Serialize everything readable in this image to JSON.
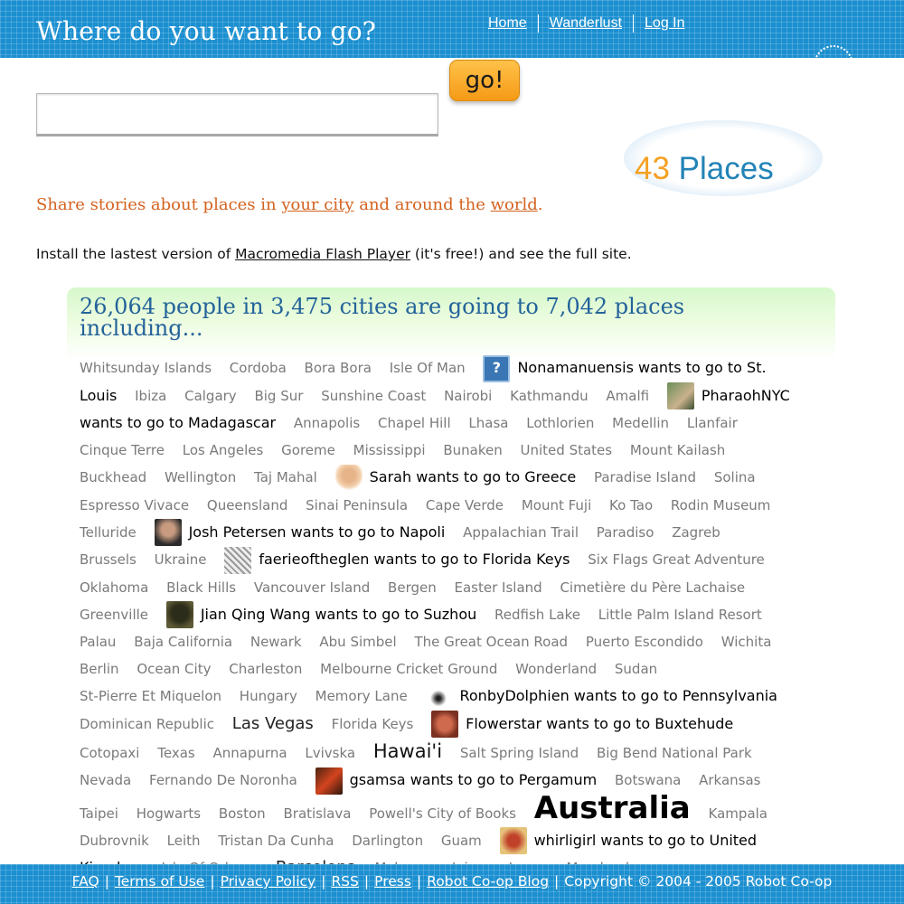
{
  "header": {
    "title": "Where do you want to go?",
    "nav": [
      "Home",
      "Wanderlust",
      "Log In"
    ]
  },
  "search": {
    "value": "",
    "placeholder": "",
    "go_label": "go!"
  },
  "logo": {
    "number": "43",
    "word": "Places"
  },
  "tagline": {
    "before": "Share stories about places in ",
    "link1": "your city",
    "middle": " and around the ",
    "link2": "world",
    "after": "."
  },
  "flash_note": {
    "before": "Install the lastest version of ",
    "link": "Macromedia Flash Player",
    "after": " (it's free!) and see the full site."
  },
  "stats": {
    "headline": "26,064 people in 3,475 cities are going to 7,042 places including..."
  },
  "cloud": [
    {
      "t": "place",
      "text": "Whitsunday Islands"
    },
    {
      "t": "place",
      "text": "Cordoba"
    },
    {
      "t": "place",
      "text": "Bora Bora"
    },
    {
      "t": "place",
      "text": "Isle Of Man"
    },
    {
      "t": "wish",
      "av": "av-q",
      "icon": "question-avatar-icon",
      "text": "Nonamanuensis wants to go to St. Louis"
    },
    {
      "t": "place",
      "text": "Ibiza"
    },
    {
      "t": "place",
      "text": "Calgary"
    },
    {
      "t": "place",
      "text": "Big Sur"
    },
    {
      "t": "place",
      "text": "Sunshine Coast"
    },
    {
      "t": "place",
      "text": "Nairobi"
    },
    {
      "t": "place",
      "text": "Kathmandu"
    },
    {
      "t": "place",
      "text": "Amalfi"
    },
    {
      "t": "wish",
      "av": "av-1",
      "icon": "user-avatar-icon",
      "text": "PharaohNYC wants to go to Madagascar"
    },
    {
      "t": "place",
      "text": "Annapolis"
    },
    {
      "t": "place",
      "text": "Chapel Hill"
    },
    {
      "t": "place",
      "text": "Lhasa"
    },
    {
      "t": "place",
      "text": "Lothlorien"
    },
    {
      "t": "place",
      "text": "Medellin"
    },
    {
      "t": "place",
      "text": "Llanfair"
    },
    {
      "t": "place",
      "text": "Cinque Terre"
    },
    {
      "t": "place",
      "text": "Los Angeles"
    },
    {
      "t": "place",
      "text": "Goreme"
    },
    {
      "t": "place",
      "text": "Mississippi"
    },
    {
      "t": "place",
      "text": "Bunaken"
    },
    {
      "t": "place",
      "text": "United States"
    },
    {
      "t": "place",
      "text": "Mount Kailash"
    },
    {
      "t": "place",
      "text": "Buckhead"
    },
    {
      "t": "place",
      "text": "Wellington"
    },
    {
      "t": "place",
      "text": "Taj Mahal"
    },
    {
      "t": "wish",
      "av": "av-2",
      "icon": "user-avatar-icon",
      "text": "Sarah wants to go to Greece"
    },
    {
      "t": "place",
      "text": "Paradise Island"
    },
    {
      "t": "place",
      "text": "Solina"
    },
    {
      "t": "place",
      "text": "Espresso Vivace"
    },
    {
      "t": "place",
      "text": "Queensland"
    },
    {
      "t": "place",
      "text": "Sinai Peninsula"
    },
    {
      "t": "place",
      "text": "Cape Verde"
    },
    {
      "t": "place",
      "text": "Mount Fuji"
    },
    {
      "t": "place",
      "text": "Ko Tao"
    },
    {
      "t": "place",
      "text": "Rodin Museum"
    },
    {
      "t": "place",
      "text": "Telluride"
    },
    {
      "t": "wish",
      "av": "av-3",
      "icon": "user-avatar-icon",
      "text": "Josh Petersen wants to go to Napoli"
    },
    {
      "t": "place",
      "text": "Appalachian Trail"
    },
    {
      "t": "place",
      "text": "Paradiso"
    },
    {
      "t": "place",
      "text": "Zagreb"
    },
    {
      "t": "place",
      "text": "Brussels"
    },
    {
      "t": "place",
      "text": "Ukraine"
    },
    {
      "t": "wish",
      "av": "av-4",
      "icon": "user-avatar-icon",
      "text": "faerieoftheglen wants to go to Florida Keys"
    },
    {
      "t": "place",
      "text": "Six Flags Great Adventure"
    },
    {
      "t": "place",
      "text": "Oklahoma"
    },
    {
      "t": "place",
      "text": "Black Hills"
    },
    {
      "t": "place",
      "text": "Vancouver Island"
    },
    {
      "t": "place",
      "text": "Bergen"
    },
    {
      "t": "place",
      "text": "Easter Island"
    },
    {
      "t": "place",
      "text": "Cimetière du Père Lachaise"
    },
    {
      "t": "place",
      "text": "Greenville"
    },
    {
      "t": "wish",
      "av": "av-5",
      "icon": "user-avatar-icon",
      "text": "Jian Qing Wang wants to go to Suzhou"
    },
    {
      "t": "place",
      "text": "Redfish Lake"
    },
    {
      "t": "place",
      "text": "Little Palm Island Resort"
    },
    {
      "t": "place",
      "text": "Palau"
    },
    {
      "t": "place",
      "text": "Baja California"
    },
    {
      "t": "place",
      "text": "Newark"
    },
    {
      "t": "place",
      "text": "Abu Simbel"
    },
    {
      "t": "place",
      "text": "The Great Ocean Road"
    },
    {
      "t": "place",
      "text": "Puerto Escondido"
    },
    {
      "t": "place",
      "text": "Wichita"
    },
    {
      "t": "place",
      "text": "Berlin"
    },
    {
      "t": "place",
      "text": "Ocean City"
    },
    {
      "t": "place",
      "text": "Charleston"
    },
    {
      "t": "place",
      "text": "Melbourne Cricket Ground"
    },
    {
      "t": "place",
      "text": "Wonderland"
    },
    {
      "t": "place",
      "text": "Sudan"
    },
    {
      "t": "place",
      "text": "St-Pierre Et Miquelon"
    },
    {
      "t": "place",
      "text": "Hungary"
    },
    {
      "t": "place",
      "text": "Memory Lane"
    },
    {
      "t": "wish",
      "av": "av-6",
      "icon": "user-avatar-icon",
      "text": "RonbyDolphien wants to go to Pennsylvania"
    },
    {
      "t": "place",
      "text": "Dominican Republic"
    },
    {
      "t": "place",
      "size": "med",
      "text": "Las Vegas"
    },
    {
      "t": "place",
      "text": "Florida Keys"
    },
    {
      "t": "wish",
      "av": "av-7",
      "icon": "user-avatar-icon",
      "text": "Flowerstar wants to go to Buxtehude"
    },
    {
      "t": "place",
      "text": "Cotopaxi"
    },
    {
      "t": "place",
      "text": "Texas"
    },
    {
      "t": "place",
      "text": "Annapurna"
    },
    {
      "t": "place",
      "text": "Lvivska"
    },
    {
      "t": "place",
      "size": "big",
      "text": "Hawai'i"
    },
    {
      "t": "place",
      "text": "Salt Spring Island"
    },
    {
      "t": "place",
      "text": "Big Bend National Park"
    },
    {
      "t": "place",
      "text": "Nevada"
    },
    {
      "t": "place",
      "text": "Fernando De Noronha"
    },
    {
      "t": "wish",
      "av": "av-8",
      "icon": "user-avatar-icon",
      "text": "gsamsa wants to go to Pergamum"
    },
    {
      "t": "place",
      "text": "Botswana"
    },
    {
      "t": "place",
      "text": "Arkansas"
    },
    {
      "t": "place",
      "text": "Taipei"
    },
    {
      "t": "place",
      "text": "Hogwarts"
    },
    {
      "t": "place",
      "text": "Boston"
    },
    {
      "t": "place",
      "text": "Bratislava"
    },
    {
      "t": "place",
      "text": "Powell's City of Books"
    },
    {
      "t": "place",
      "size": "huge",
      "text": "Australia"
    },
    {
      "t": "place",
      "text": "Kampala"
    },
    {
      "t": "place",
      "text": "Dubrovnik"
    },
    {
      "t": "place",
      "text": "Leith"
    },
    {
      "t": "place",
      "text": "Tristan Da Cunha"
    },
    {
      "t": "place",
      "text": "Darlington"
    },
    {
      "t": "place",
      "text": "Guam"
    },
    {
      "t": "wish",
      "av": "av-9",
      "icon": "user-avatar-icon",
      "text": "whirligirl wants to go to United Kingdom"
    },
    {
      "t": "place",
      "text": "Isle Of Orkney"
    },
    {
      "t": "place",
      "size": "med",
      "text": "Barcelona"
    },
    {
      "t": "place",
      "text": "Mykonos"
    },
    {
      "t": "place",
      "text": "Jaipur"
    },
    {
      "t": "place",
      "text": "Lagos"
    },
    {
      "t": "place",
      "text": "Maryland"
    }
  ],
  "footer": {
    "links": [
      "FAQ",
      "Terms of Use",
      "Privacy Policy",
      "RSS",
      "Press",
      "Robot Co-op Blog"
    ],
    "copyright": "Copyright © 2004 - 2005 Robot Co-op"
  },
  "colors": {
    "bar_blue": "#1b8fd0",
    "headline_blue": "#23639a",
    "tagline_orange": "#d3621f",
    "go_orange": "#f59a16"
  }
}
